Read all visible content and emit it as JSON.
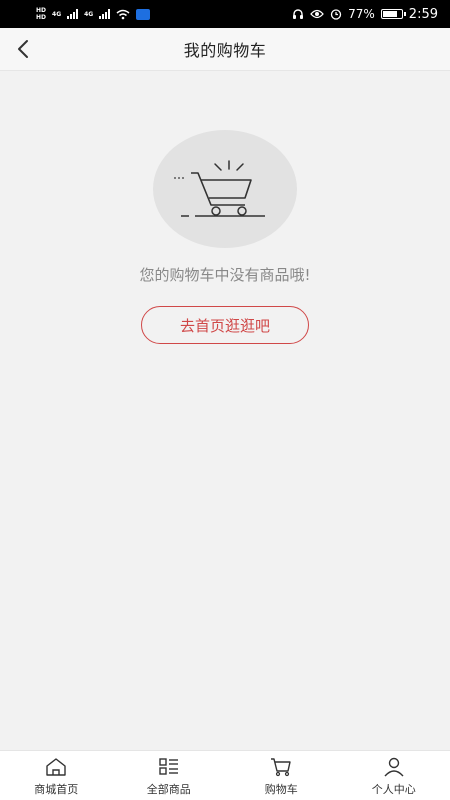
{
  "status_bar": {
    "left_tiny_top": "HD",
    "left_tiny_bottom": "HD",
    "network1": "4G",
    "network2": "4G",
    "battery_percent": "77%",
    "time": "2:59"
  },
  "header": {
    "title": "我的购物车"
  },
  "empty_state": {
    "message": "您的购物车中没有商品哦!",
    "button_label": "去首页逛逛吧"
  },
  "bottom_nav": {
    "items": [
      {
        "label": "商城首页",
        "icon": "home-icon"
      },
      {
        "label": "全部商品",
        "icon": "category-icon"
      },
      {
        "label": "购物车",
        "icon": "cart-icon"
      },
      {
        "label": "个人中心",
        "icon": "user-icon"
      }
    ]
  },
  "colors": {
    "accent": "#d04848",
    "background": "#f2f2f2"
  }
}
